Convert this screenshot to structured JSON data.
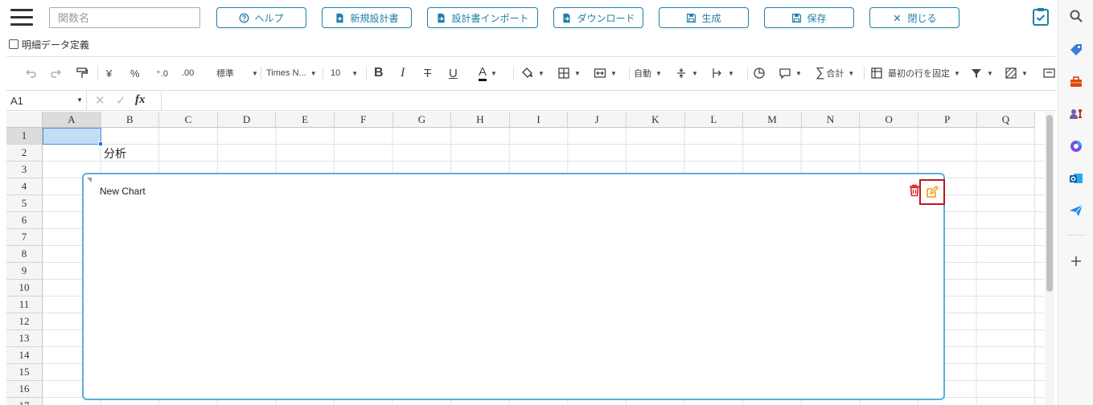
{
  "topbar": {
    "search_placeholder": "関数名",
    "buttons": {
      "help": "ヘルプ",
      "new_design": "新規設計書",
      "import": "設計書インポート",
      "download": "ダウンロード",
      "generate": "生成",
      "save": "保存",
      "close": "閉じる"
    }
  },
  "detail_label": "明細データ定義",
  "ribbon": {
    "style_select": "標準",
    "font_select": "Times N...",
    "size_select": "10",
    "align_select": "自動",
    "sum_label": "合計",
    "freeze_label": "最初の行を固定"
  },
  "formula": {
    "cell_ref": "A1",
    "fx_label": "fx"
  },
  "sheet": {
    "columns": [
      "A",
      "B",
      "C",
      "D",
      "E",
      "F",
      "G",
      "H",
      "I",
      "J",
      "K",
      "L",
      "M",
      "N",
      "O",
      "P",
      "Q"
    ],
    "rows": [
      "1",
      "2",
      "3",
      "4",
      "5",
      "6",
      "7",
      "8",
      "9",
      "10",
      "11",
      "12",
      "13",
      "14",
      "15",
      "16",
      "17"
    ],
    "b2_value": "分析"
  },
  "chart": {
    "title": "New Chart"
  },
  "colors": {
    "primary": "#1f7fa8",
    "chart_border": "#5bb0d8",
    "highlight": "#b8191c",
    "edit_icon": "#f39c12",
    "trash_icon": "#d9252a"
  }
}
